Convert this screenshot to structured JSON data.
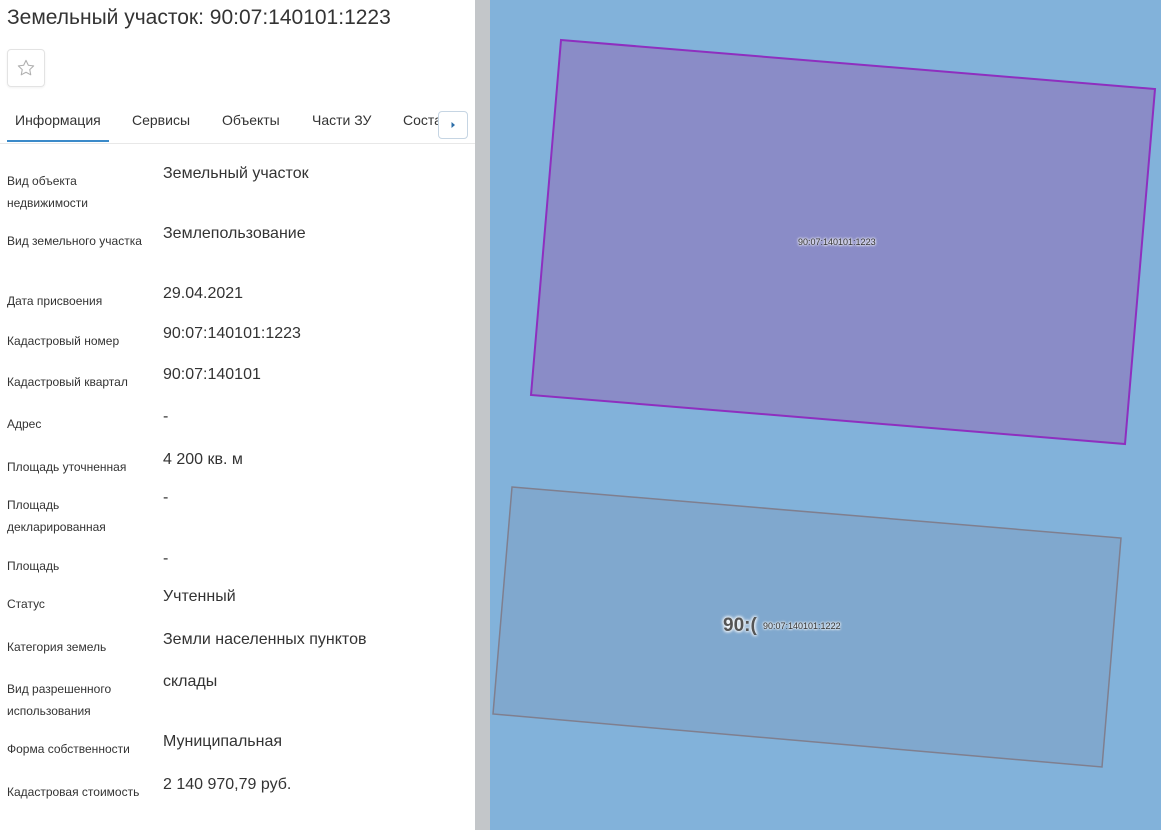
{
  "header": {
    "title": "Земельный участок: 90:07:140101:1223",
    "favorite_icon": "star-outline-icon"
  },
  "tabs": [
    {
      "label": "Информация",
      "active": true
    },
    {
      "label": "Сервисы",
      "active": false
    },
    {
      "label": "Объекты",
      "active": false
    },
    {
      "label": "Части ЗУ",
      "active": false
    },
    {
      "label": "Соста",
      "active": false
    }
  ],
  "tabs_scroll_icon": "chevron-right-icon",
  "info": [
    {
      "label": "Вид объекта недвижимости",
      "value": "Земельный участок"
    },
    {
      "label": "Вид земельного участка",
      "value": "Землепользование"
    },
    {
      "label": "Дата присвоения",
      "value": "29.04.2021"
    },
    {
      "label": "Кадастровый номер",
      "value": "90:07:140101:1223"
    },
    {
      "label": "Кадастровый квартал",
      "value": "90:07:140101"
    },
    {
      "label": "Адрес",
      "value": "-"
    },
    {
      "label": "Площадь уточненная",
      "value": "4 200 кв. м"
    },
    {
      "label": "Площадь декларированная",
      "value": "-"
    },
    {
      "label": "Площадь",
      "value": "-"
    },
    {
      "label": "Статус",
      "value": "Учтенный"
    },
    {
      "label": "Категория земель",
      "value": "Земли населенных пунктов"
    },
    {
      "label": "Вид разрешенного использования",
      "value": "склады"
    },
    {
      "label": "Форма собственности",
      "value": "Муниципальная"
    },
    {
      "label": "Кадастровая стоимость",
      "value": "2 140 970,79 руб."
    }
  ],
  "map": {
    "background_color": "#82b2da",
    "selected_parcel": {
      "label": "90:07:140101:1223",
      "fill": "#8a8cc7",
      "stroke": "#8e2fbf"
    },
    "neighbor_parcel": {
      "label": "90:07:140101:1222",
      "partial_label": "90:(",
      "stroke": "#7f7f8f"
    }
  }
}
